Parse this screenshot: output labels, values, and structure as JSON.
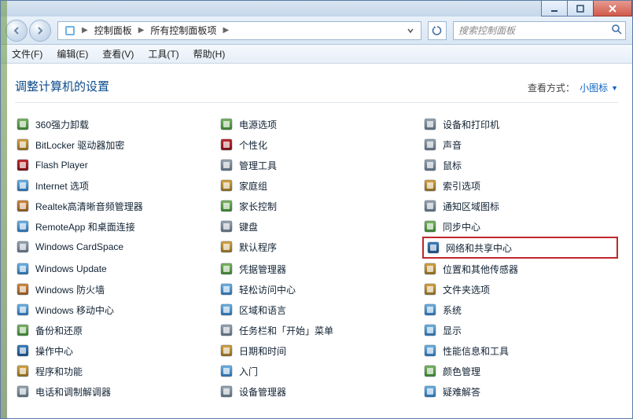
{
  "window": {
    "min_tip": "Minimize",
    "max_tip": "Maximize",
    "close_tip": "Close"
  },
  "breadcrumb": {
    "seg1_icon": "control-panel-icon",
    "seg1": "控制面板",
    "seg2": "所有控制面板项"
  },
  "search": {
    "placeholder": "搜索控制面板"
  },
  "menus": {
    "file": "文件(F)",
    "edit": "编辑(E)",
    "view": "查看(V)",
    "tools": "工具(T)",
    "help": "帮助(H)"
  },
  "page": {
    "title": "调整计算机的设置",
    "viewby_label": "查看方式：",
    "viewby_value": "小图标"
  },
  "items": [
    {
      "label": "360强力卸载",
      "icon": "uninstall",
      "hl": false,
      "c1": "#7bb661",
      "c2": "#3a7d2e"
    },
    {
      "label": "BitLocker 驱动器加密",
      "icon": "lock",
      "hl": false,
      "c1": "#d9a441",
      "c2": "#8a6a1e"
    },
    {
      "label": "Flash Player",
      "icon": "flash",
      "hl": false,
      "c1": "#c1272d",
      "c2": "#7a0f14"
    },
    {
      "label": "Internet 选项",
      "icon": "globe",
      "hl": false,
      "c1": "#6eb4e6",
      "c2": "#2a6ca8"
    },
    {
      "label": "Realtek高清晰音频管理器",
      "icon": "audio",
      "hl": false,
      "c1": "#d48a3a",
      "c2": "#8a541e"
    },
    {
      "label": "RemoteApp 和桌面连接",
      "icon": "remote",
      "hl": false,
      "c1": "#6eb4e6",
      "c2": "#2a6ca8"
    },
    {
      "label": "Windows CardSpace",
      "icon": "card",
      "hl": false,
      "c1": "#9aa6b2",
      "c2": "#5a6a7a"
    },
    {
      "label": "Windows Update",
      "icon": "update",
      "hl": false,
      "c1": "#6eb4e6",
      "c2": "#2a6ca8"
    },
    {
      "label": "Windows 防火墙",
      "icon": "firewall",
      "hl": false,
      "c1": "#d48a3a",
      "c2": "#a04a1e"
    },
    {
      "label": "Windows 移动中心",
      "icon": "mobility",
      "hl": false,
      "c1": "#6eb4e6",
      "c2": "#2a6ca8"
    },
    {
      "label": "备份和还原",
      "icon": "backup",
      "hl": false,
      "c1": "#7bb661",
      "c2": "#3a7d2e"
    },
    {
      "label": "操作中心",
      "icon": "flag",
      "hl": false,
      "c1": "#3a7dc1",
      "c2": "#1a4a7a"
    },
    {
      "label": "程序和功能",
      "icon": "programs",
      "hl": false,
      "c1": "#d9a441",
      "c2": "#8a6a1e"
    },
    {
      "label": "电话和调制解调器",
      "icon": "phone",
      "hl": false,
      "c1": "#9aa6b2",
      "c2": "#5a6a7a"
    },
    {
      "label": "电源选项",
      "icon": "power",
      "hl": false,
      "c1": "#7bb661",
      "c2": "#3a7d2e"
    },
    {
      "label": "个性化",
      "icon": "personal",
      "hl": false,
      "c1": "#c1272d",
      "c2": "#7a0f14"
    },
    {
      "label": "管理工具",
      "icon": "admin",
      "hl": false,
      "c1": "#9aa6b2",
      "c2": "#5a6a7a"
    },
    {
      "label": "家庭组",
      "icon": "homegroup",
      "hl": false,
      "c1": "#d9a441",
      "c2": "#8a6a1e"
    },
    {
      "label": "家长控制",
      "icon": "parental",
      "hl": false,
      "c1": "#7bb661",
      "c2": "#3a7d2e"
    },
    {
      "label": "键盘",
      "icon": "keyboard",
      "hl": false,
      "c1": "#9aa6b2",
      "c2": "#5a6a7a"
    },
    {
      "label": "默认程序",
      "icon": "default",
      "hl": false,
      "c1": "#d9a441",
      "c2": "#8a6a1e"
    },
    {
      "label": "凭据管理器",
      "icon": "cred",
      "hl": false,
      "c1": "#7bb661",
      "c2": "#3a7d2e"
    },
    {
      "label": "轻松访问中心",
      "icon": "ease",
      "hl": false,
      "c1": "#6eb4e6",
      "c2": "#2a6ca8"
    },
    {
      "label": "区域和语言",
      "icon": "region",
      "hl": false,
      "c1": "#6eb4e6",
      "c2": "#2a6ca8"
    },
    {
      "label": "任务栏和「开始」菜单",
      "icon": "taskbar",
      "hl": false,
      "c1": "#9aa6b2",
      "c2": "#5a6a7a"
    },
    {
      "label": "日期和时间",
      "icon": "clock",
      "hl": false,
      "c1": "#d9a441",
      "c2": "#8a6a1e"
    },
    {
      "label": "入门",
      "icon": "getting",
      "hl": false,
      "c1": "#6eb4e6",
      "c2": "#2a6ca8"
    },
    {
      "label": "设备管理器",
      "icon": "devmgr",
      "hl": false,
      "c1": "#9aa6b2",
      "c2": "#5a6a7a"
    },
    {
      "label": "设备和打印机",
      "icon": "printer",
      "hl": false,
      "c1": "#9aa6b2",
      "c2": "#5a6a7a"
    },
    {
      "label": "声音",
      "icon": "sound",
      "hl": false,
      "c1": "#9aa6b2",
      "c2": "#5a6a7a"
    },
    {
      "label": "鼠标",
      "icon": "mouse",
      "hl": false,
      "c1": "#9aa6b2",
      "c2": "#5a6a7a"
    },
    {
      "label": "索引选项",
      "icon": "index",
      "hl": false,
      "c1": "#d9a441",
      "c2": "#8a6a1e"
    },
    {
      "label": "通知区域图标",
      "icon": "tray",
      "hl": false,
      "c1": "#9aa6b2",
      "c2": "#5a6a7a"
    },
    {
      "label": "同步中心",
      "icon": "sync",
      "hl": false,
      "c1": "#7bb661",
      "c2": "#3a7d2e"
    },
    {
      "label": "网络和共享中心",
      "icon": "network",
      "hl": true,
      "c1": "#3a7dc1",
      "c2": "#1a4a7a"
    },
    {
      "label": "位置和其他传感器",
      "icon": "location",
      "hl": false,
      "c1": "#d9a441",
      "c2": "#8a6a1e"
    },
    {
      "label": "文件夹选项",
      "icon": "folder",
      "hl": false,
      "c1": "#d9a441",
      "c2": "#8a6a1e"
    },
    {
      "label": "系统",
      "icon": "system",
      "hl": false,
      "c1": "#6eb4e6",
      "c2": "#2a6ca8"
    },
    {
      "label": "显示",
      "icon": "display",
      "hl": false,
      "c1": "#6eb4e6",
      "c2": "#2a6ca8"
    },
    {
      "label": "性能信息和工具",
      "icon": "perf",
      "hl": false,
      "c1": "#6eb4e6",
      "c2": "#2a6ca8"
    },
    {
      "label": "颜色管理",
      "icon": "color",
      "hl": false,
      "c1": "#7bb661",
      "c2": "#3a7d2e"
    },
    {
      "label": "疑难解答",
      "icon": "trouble",
      "hl": false,
      "c1": "#6eb4e6",
      "c2": "#2a6ca8"
    }
  ]
}
